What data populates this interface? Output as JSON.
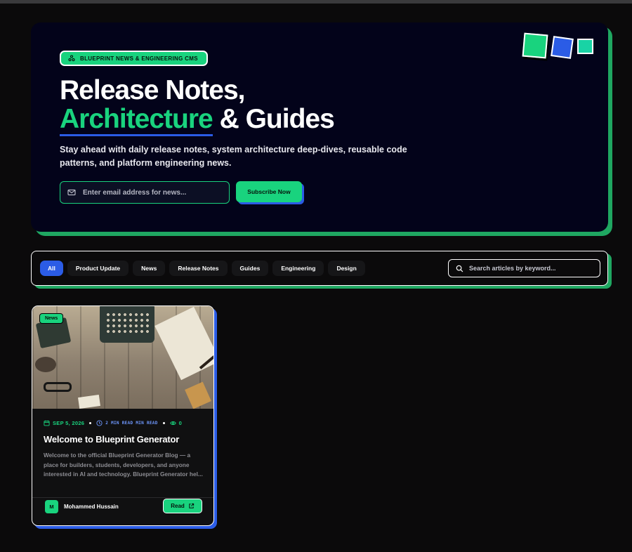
{
  "hero": {
    "badge": "BLUEPRINT NEWS & ENGINEERING CMS",
    "title_line1": "Release Notes,",
    "title_accent": "Architecture",
    "title_rest": " & Guides",
    "subtitle": "Stay ahead with daily release notes, system architecture deep-dives, reusable code patterns, and platform engineering news.",
    "email_placeholder": "Enter email address for news...",
    "subscribe_label": "Subscribe Now"
  },
  "filters": {
    "tabs": [
      "All",
      "Product Update",
      "News",
      "Release Notes",
      "Guides",
      "Engineering",
      "Design"
    ],
    "active": "All",
    "search_placeholder": "Search articles by keyword..."
  },
  "posts": [
    {
      "tag": "News",
      "date": "SEP 5, 2026",
      "read_time": "2 MIN READ MIN READ",
      "views": "0",
      "title": "Welcome to Blueprint Generator",
      "excerpt": "Welcome to the official Blueprint Generator Blog — a place for builders, students, developers, and anyone interested in AI and technology. Blueprint Generator hel...",
      "author_initial": "M",
      "author": "Mohammed Hussain",
      "read_label": "Read"
    }
  ],
  "colors": {
    "background": "#0b0a0b",
    "hero_bg": "#03031a",
    "accent_green": "#19d37e",
    "accent_blue": "#2b5ce6",
    "shadow_green": "#1fa761"
  },
  "icons": [
    "layers-icon",
    "mail-icon",
    "search-icon",
    "calendar-icon",
    "clock-icon",
    "eye-icon",
    "external-link-icon"
  ]
}
